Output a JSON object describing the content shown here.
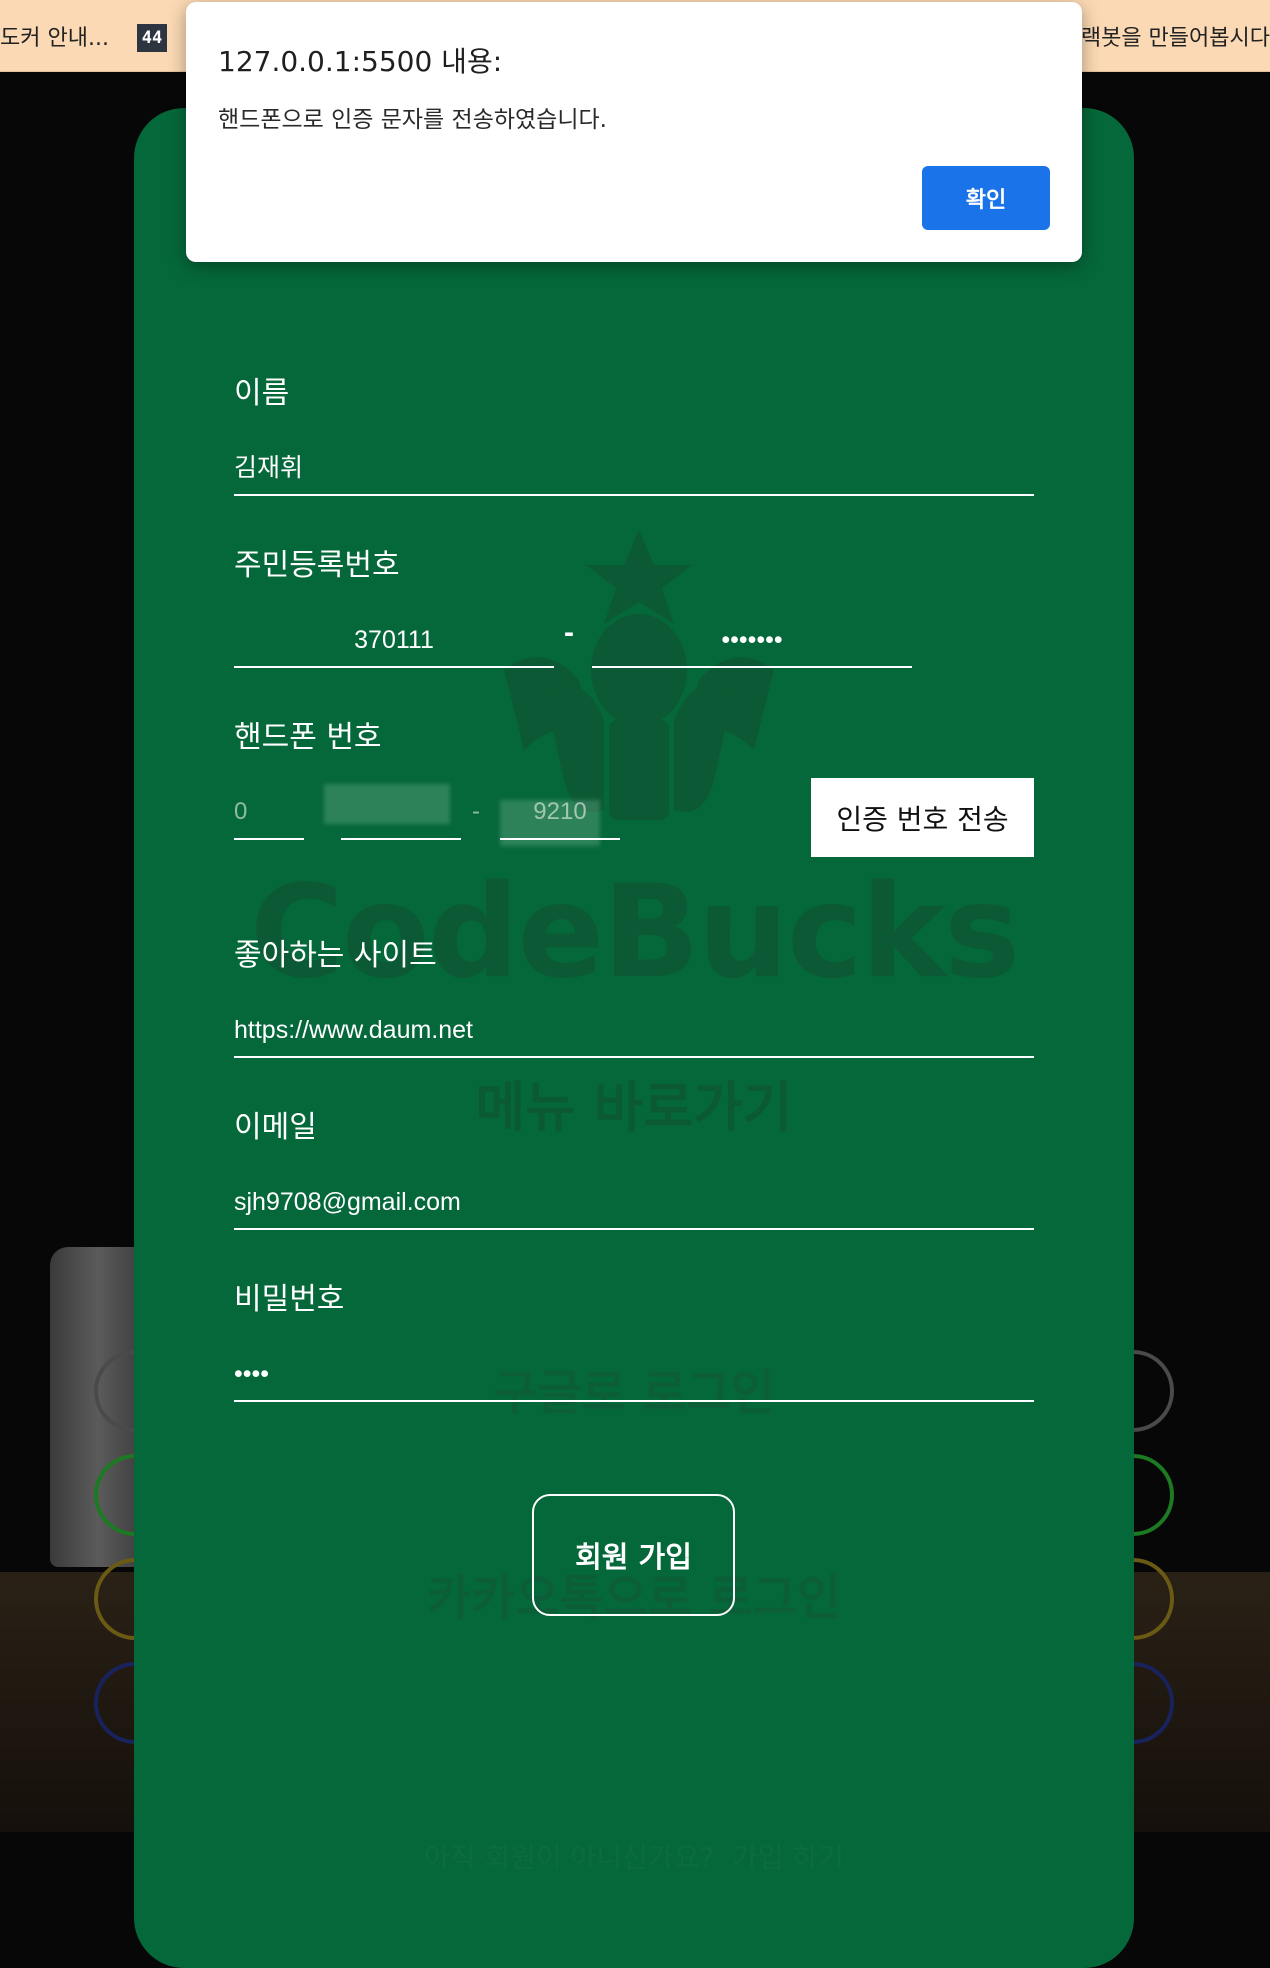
{
  "bookmarks": {
    "left_item": "도커 안내...",
    "badge": "44",
    "right_item": "ㄱ랙봇을 만들어봅시다"
  },
  "colors": {
    "card": "#05683a",
    "dialog_button": "#1a73e8",
    "bookmarks_bar": "#fbd9b4"
  },
  "background": {
    "brand": "CodeBucks",
    "menu_link": "메뉴 바로가기",
    "login_google": "구글로 로그인",
    "login_kakao": "카카오톡으로 로그인",
    "signup_prompt": "아직 회원이 아니신가요?",
    "signup_link": "가입 하기"
  },
  "dialog": {
    "title": "127.0.0.1:5500 내용:",
    "message": "핸드폰으로 인증 문자를 전송하였습니다.",
    "ok_label": "확인"
  },
  "form": {
    "name_label": "이름",
    "name_value": "김재휘",
    "jumin_label": "주민등록번호",
    "jumin_front": "370111",
    "jumin_separator": "-",
    "jumin_back": "•••••••",
    "phone_label": "핸드폰 번호",
    "phone_first": "0",
    "phone_separator": "-",
    "phone_last": "9210",
    "send_code_label": "인증 번호 전송",
    "site_label": "좋아하는 사이트",
    "site_value": "https://www.daum.net",
    "email_label": "이메일",
    "email_value": "sjh9708@gmail.com",
    "password_label": "비밀번호",
    "password_value": "••••",
    "submit_label": "회원 가입"
  }
}
